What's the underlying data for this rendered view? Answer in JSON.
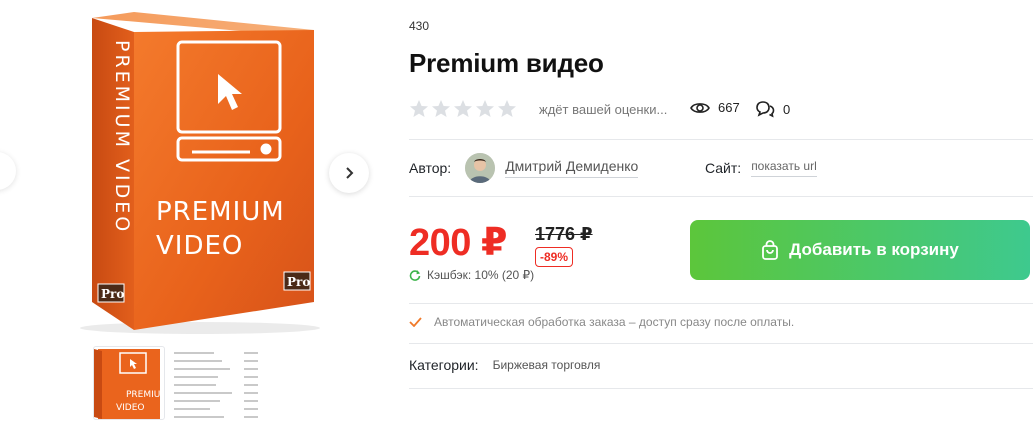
{
  "gallery": {
    "box_text_side": "PREMIUM VIDEO",
    "box_text_front_1": "PREMIUM",
    "box_text_front_2": "VIDEO",
    "box_badge": "Pro",
    "colors": {
      "box_orange": "#f0641c",
      "box_dark": "#c2410c"
    }
  },
  "product": {
    "id": "430",
    "title": "Premium видео",
    "rating_text": "ждёт вашей оценки...",
    "views": "667",
    "comments": "0"
  },
  "author": {
    "label": "Автор:",
    "name": "Дмитрий Демиденко"
  },
  "site": {
    "label": "Сайт:",
    "link": "показать url"
  },
  "pricing": {
    "price": "200 ₽",
    "old_price": "1776 ₽",
    "discount": "-89%",
    "cashback": "Кэшбэк: 10% (20 ₽)",
    "add_to_cart": "Добавить в корзину"
  },
  "info": {
    "auto_processing": "Автоматическая обработка заказа – доступ сразу после оплаты."
  },
  "categories": {
    "label": "Категории:",
    "value": "Биржевая торговля"
  },
  "colors": {
    "price_red": "#ee2d24",
    "button_green_start": "#5cc63b",
    "button_green_end": "#3ec98e"
  }
}
